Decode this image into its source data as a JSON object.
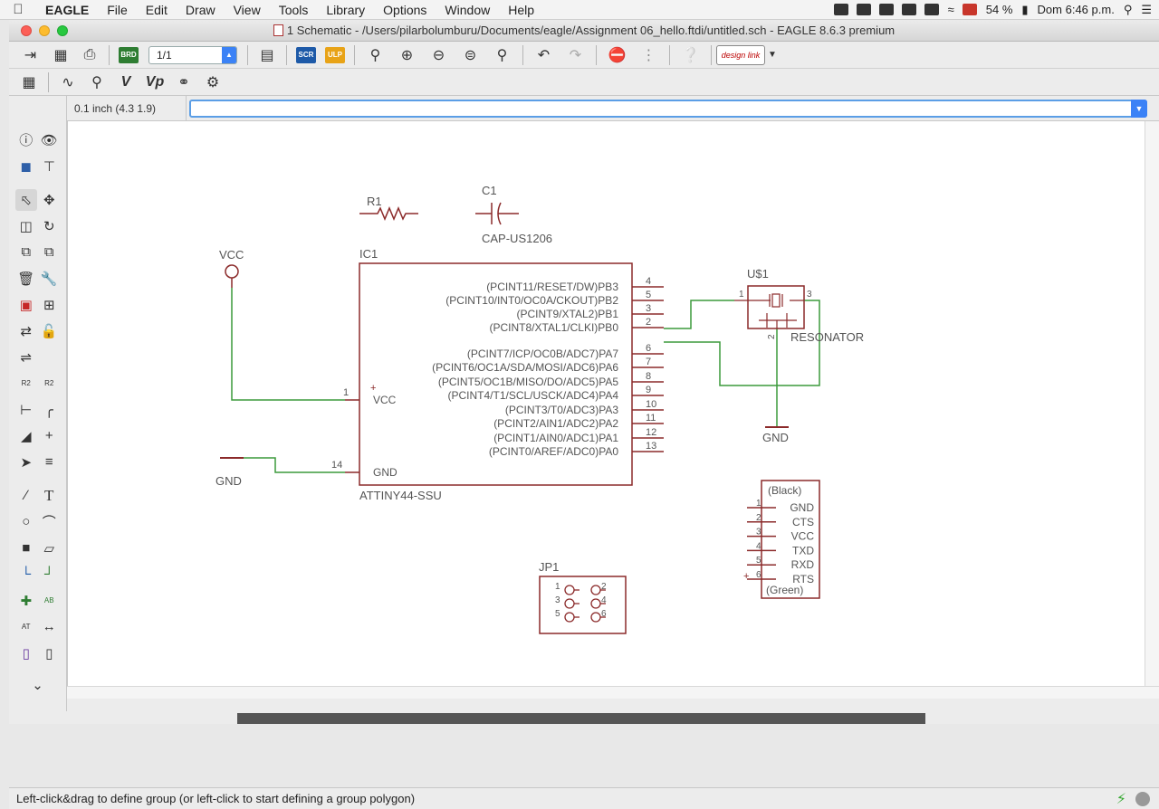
{
  "menubar": {
    "app": "EAGLE",
    "items": [
      "File",
      "Edit",
      "Draw",
      "View",
      "Tools",
      "Library",
      "Options",
      "Window",
      "Help"
    ],
    "battery": "54 %",
    "clock": "Dom 6:46 p.m."
  },
  "window": {
    "title": "1 Schematic - /Users/pilarbolumburu/Documents/eagle/Assignment 06_hello.ftdi/untitled.sch - EAGLE 8.6.3 premium"
  },
  "toolbar": {
    "sheet": "1/1",
    "brd_label": "BRD",
    "scr_label": "SCR",
    "ulp_label": "ULP",
    "design_link": "design link"
  },
  "coord": "0.1 inch (4.3 1.9)",
  "command_value": "",
  "status": "Left-click&drag to define group (or left-click to start defining a group polygon)",
  "schematic": {
    "r1": {
      "name": "R1"
    },
    "c1": {
      "name": "C1",
      "value": "CAP-US1206"
    },
    "vcc_symbol": "VCC",
    "gnd_symbol": "GND",
    "ic1": {
      "name": "IC1",
      "value": "ATTINY44-SSU",
      "pins_right": [
        {
          "label": "(PCINT11/RESET/DW)PB3",
          "num": "4"
        },
        {
          "label": "(PCINT10/INT0/OC0A/CKOUT)PB2",
          "num": "5"
        },
        {
          "label": "(PCINT9/XTAL2)PB1",
          "num": "3"
        },
        {
          "label": "(PCINT8/XTAL1/CLKI)PB0",
          "num": "2"
        },
        {
          "label": "(PCINT7/ICP/OC0B/ADC7)PA7",
          "num": "6"
        },
        {
          "label": "(PCINT6/OC1A/SDA/MOSI/ADC6)PA6",
          "num": "7"
        },
        {
          "label": "(PCINT5/OC1B/MISO/DO/ADC5)PA5",
          "num": "8"
        },
        {
          "label": "(PCINT4/T1/SCL/USCK/ADC4)PA4",
          "num": "9"
        },
        {
          "label": "(PCINT3/T0/ADC3)PA3",
          "num": "10"
        },
        {
          "label": "(PCINT2/AIN1/ADC2)PA2",
          "num": "11"
        },
        {
          "label": "(PCINT1/AIN0/ADC1)PA1",
          "num": "12"
        },
        {
          "label": "(PCINT0/AREF/ADC0)PA0",
          "num": "13"
        }
      ],
      "pin_vcc": {
        "label": "VCC",
        "num": "1"
      },
      "pin_gnd": {
        "label": "GND",
        "num": "14"
      }
    },
    "u1": {
      "name": "U$1",
      "value": "RESONATOR",
      "pin1": "1",
      "pin2": "2",
      "pin3": "3"
    },
    "ftdi": {
      "top": "(Black)",
      "bottom": "(Green)",
      "pins": [
        {
          "num": "1",
          "label": "GND"
        },
        {
          "num": "2",
          "label": "CTS"
        },
        {
          "num": "3",
          "label": "VCC"
        },
        {
          "num": "4",
          "label": "TXD"
        },
        {
          "num": "5",
          "label": "RXD"
        },
        {
          "num": "6",
          "label": "RTS"
        }
      ]
    },
    "jp1": {
      "name": "JP1",
      "pins": [
        "1",
        "2",
        "3",
        "4",
        "5",
        "6"
      ]
    }
  }
}
